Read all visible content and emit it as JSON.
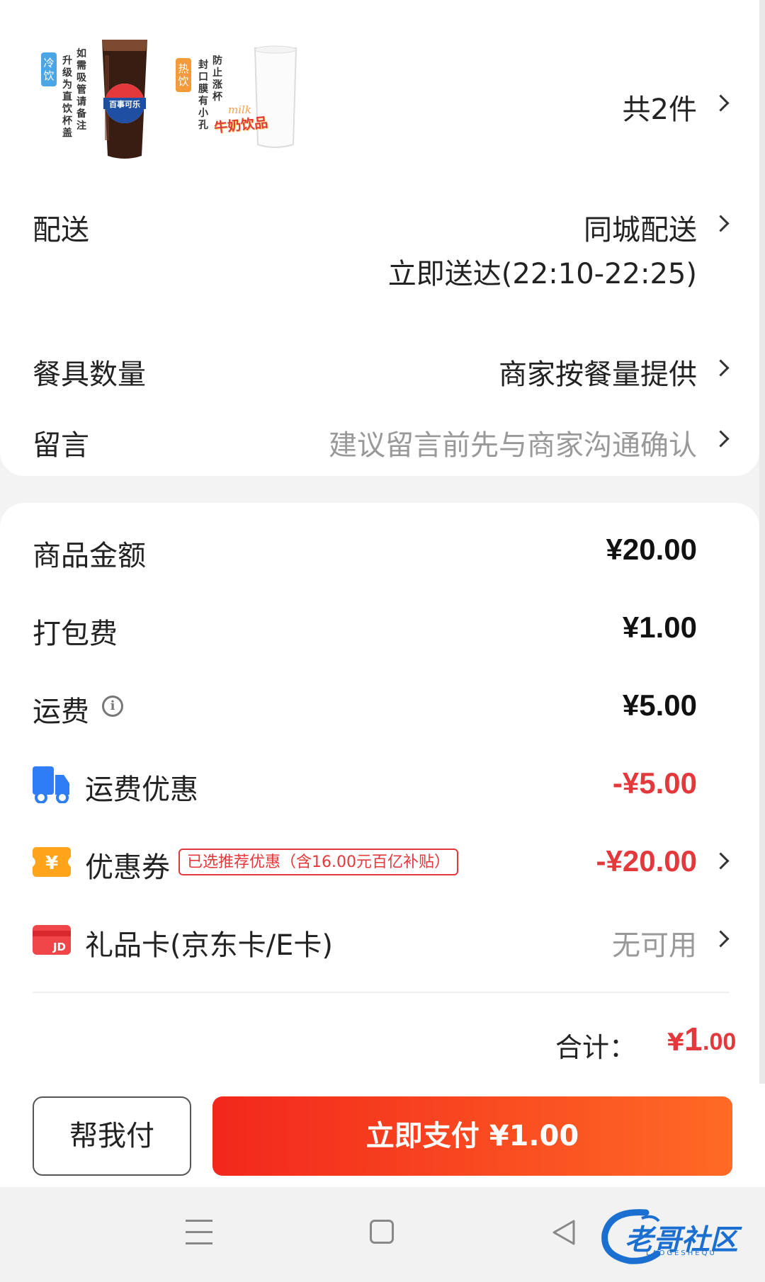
{
  "products": {
    "item1": {
      "tag": "冷饮",
      "note_col1": "升级为直饮杯盖",
      "note_col2": "如需吸管请备注",
      "brand": "百事可乐"
    },
    "item2": {
      "tag": "热饮",
      "note_col1": "封口膜有小孔",
      "note_col2": "防止涨杯",
      "brand": "牛奶饮品",
      "script": "milk"
    },
    "count": "共2件"
  },
  "delivery": {
    "label": "配送",
    "method": "同城配送",
    "time": "立即送达(22:10-22:25)"
  },
  "utensils": {
    "label": "餐具数量",
    "value": "商家按餐量提供"
  },
  "message": {
    "label": "留言",
    "placeholder": "建议留言前先与商家沟通确认"
  },
  "fees": {
    "goods": {
      "label": "商品金额",
      "value": "¥20.00"
    },
    "packing": {
      "label": "打包费",
      "value": "¥1.00"
    },
    "shipping": {
      "label": "运费",
      "value": "¥5.00",
      "icon": "info-icon"
    },
    "shipping_discount": {
      "label": "运费优惠",
      "value": "-¥5.00",
      "icon": "truck-icon"
    },
    "coupon": {
      "label": "优惠券",
      "badge": "已选推荐优惠（含16.00元百亿补贴）",
      "value": "-¥20.00",
      "icon": "coupon-icon"
    },
    "giftcard": {
      "label": "礼品卡(京东卡/E卡)",
      "value": "无可用",
      "icon": "jd-card-icon",
      "icon_text": "JD"
    }
  },
  "total": {
    "label": "合计：",
    "currency": "¥",
    "integer": "1",
    "decimal": ".00"
  },
  "actions": {
    "help_pay": "帮我付",
    "pay_now": "立即支付 ¥1.00"
  },
  "watermark": {
    "text": "老哥社区",
    "sub": "LAOGESHEQU"
  },
  "colors": {
    "accent_red": "#e4393c",
    "pay_gradient_start": "#f2271c",
    "pay_gradient_end": "#ff6a25",
    "truck_blue": "#2f7df6",
    "coupon_orange": "#ffa41b"
  }
}
